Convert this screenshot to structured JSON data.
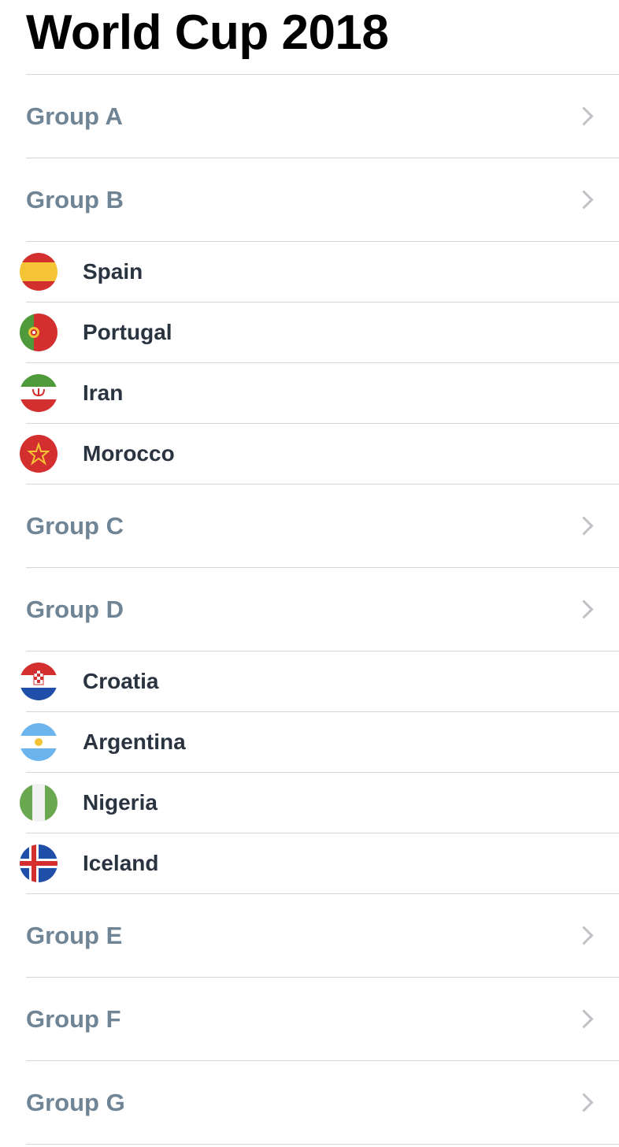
{
  "title": "World Cup 2018",
  "groups": [
    {
      "label": "Group A",
      "expanded": false,
      "teams": []
    },
    {
      "label": "Group B",
      "expanded": true,
      "teams": [
        {
          "name": "Spain",
          "flag": "spain-flag-icon"
        },
        {
          "name": "Portugal",
          "flag": "portugal-flag-icon"
        },
        {
          "name": "Iran",
          "flag": "iran-flag-icon"
        },
        {
          "name": "Morocco",
          "flag": "morocco-flag-icon"
        }
      ]
    },
    {
      "label": "Group C",
      "expanded": false,
      "teams": []
    },
    {
      "label": "Group D",
      "expanded": true,
      "teams": [
        {
          "name": "Croatia",
          "flag": "croatia-flag-icon"
        },
        {
          "name": "Argentina",
          "flag": "argentina-flag-icon"
        },
        {
          "name": "Nigeria",
          "flag": "nigeria-flag-icon"
        },
        {
          "name": "Iceland",
          "flag": "iceland-flag-icon"
        }
      ]
    },
    {
      "label": "Group E",
      "expanded": false,
      "teams": []
    },
    {
      "label": "Group F",
      "expanded": false,
      "teams": []
    },
    {
      "label": "Group G",
      "expanded": false,
      "teams": []
    }
  ],
  "colors": {
    "group_label": "#6f8596",
    "team_name": "#2a3340",
    "divider": "#d6d6d6",
    "chevron": "#c0c2c6"
  }
}
